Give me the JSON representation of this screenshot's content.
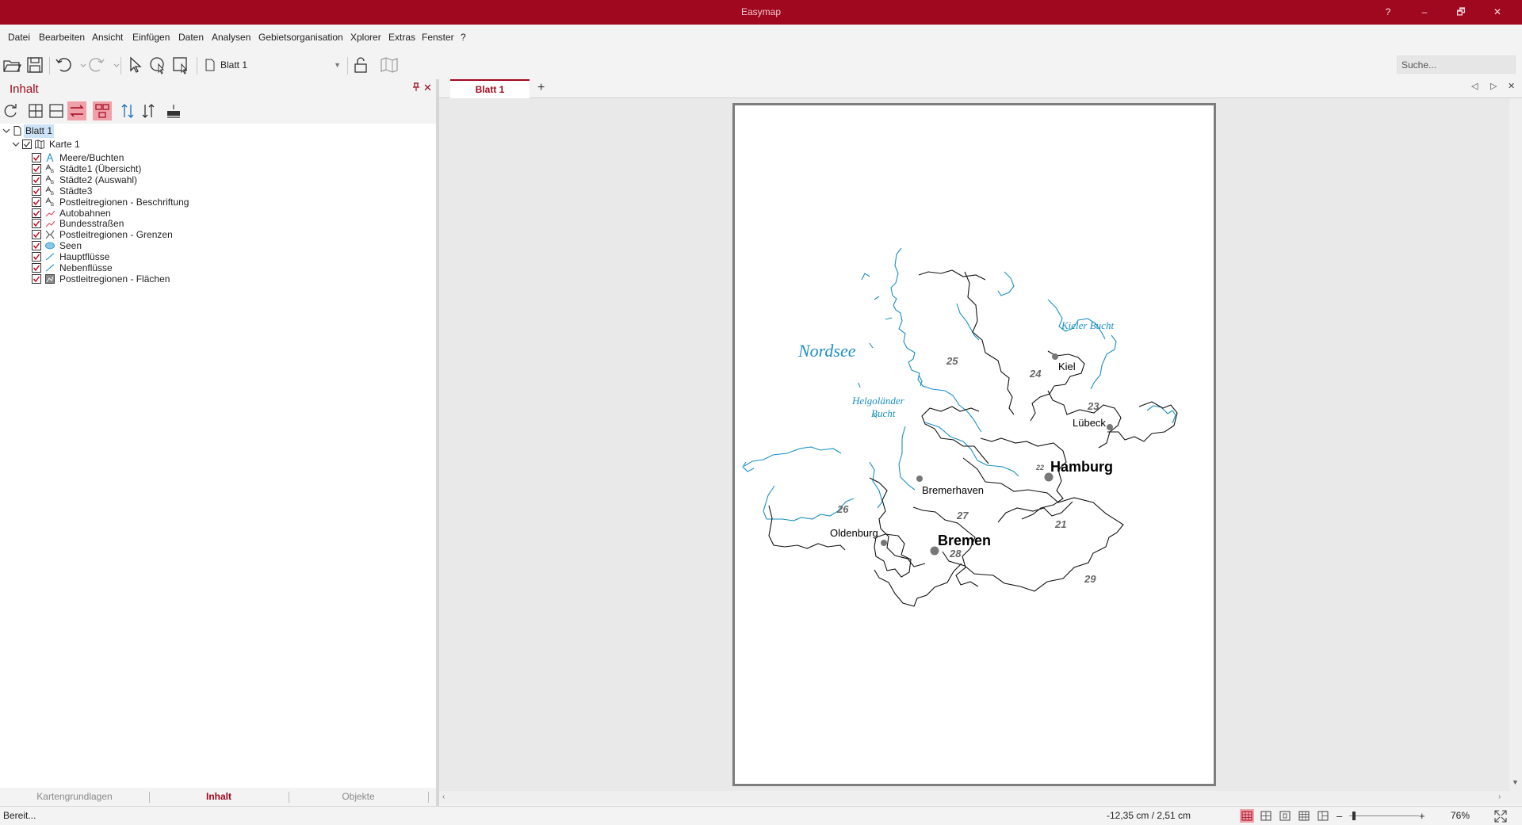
{
  "app": {
    "title": "Easymap",
    "window_controls": {
      "help": "?",
      "minimize": "–",
      "restore": "🗗",
      "close": "✕"
    }
  },
  "menu": [
    "Datei",
    "Bearbeiten",
    "Ansicht",
    "Einfügen",
    "Daten",
    "Analysen",
    "Gebietsorganisation",
    "Xplorer",
    "Extras",
    "Fenster",
    "?"
  ],
  "toolbar": {
    "page_select": "Blatt 1",
    "search_placeholder": "Suche..."
  },
  "panel": {
    "title": "Inhalt",
    "pin": "📌",
    "close": "✕",
    "tree": {
      "root": "Blatt 1",
      "map": "Karte 1",
      "layers": [
        {
          "label": "Meere/Buchten",
          "icon": "text-layer-icon",
          "checked": true
        },
        {
          "label": "Städte1 (Übersicht)",
          "icon": "label-layer-icon",
          "checked": true
        },
        {
          "label": "Städte2 (Auswahl)",
          "icon": "label-layer-icon",
          "checked": true
        },
        {
          "label": "Städte3",
          "icon": "label-layer-icon",
          "checked": true
        },
        {
          "label": "Postleitregionen - Beschriftung",
          "icon": "label-layer-icon",
          "checked": true
        },
        {
          "label": "Autobahnen",
          "icon": "road-layer-icon",
          "checked": true
        },
        {
          "label": "Bundesstraßen",
          "icon": "road-layer-icon",
          "checked": true
        },
        {
          "label": "Postleitregionen - Grenzen",
          "icon": "border-layer-icon",
          "checked": true
        },
        {
          "label": "Seen",
          "icon": "lake-layer-icon",
          "checked": true
        },
        {
          "label": "Hauptflüsse",
          "icon": "river-layer-icon",
          "checked": true
        },
        {
          "label": "Nebenflüsse",
          "icon": "river-layer-icon",
          "checked": true
        },
        {
          "label": "Postleitregionen - Flächen",
          "icon": "area-layer-icon",
          "checked": true
        }
      ]
    },
    "bottom_tabs": [
      "Kartengrundlagen",
      "Inhalt",
      "Objekte"
    ],
    "active_bottom_tab": "Inhalt"
  },
  "document": {
    "tab": "Blatt 1",
    "add_tab": "+",
    "map_labels": {
      "seas": [
        "Nordsee",
        "Kieler Bucht",
        "Helgoländer",
        "Bucht"
      ],
      "cities": [
        "Kiel",
        "Lübeck",
        "Hamburg",
        "Bremerhaven",
        "Oldenburg",
        "Bremen"
      ],
      "regions": [
        "25",
        "24",
        "23",
        "22",
        "21",
        "26",
        "27",
        "28",
        "29"
      ]
    }
  },
  "status": {
    "text": "Bereit...",
    "coords": "-12,35 cm / 2,51 cm",
    "zoom_minus": "–",
    "zoom_plus": "+",
    "zoom": "76%",
    "zoom_level": 0.04
  },
  "colors": {
    "accent": "#a0081f",
    "water": "#1a8fc4",
    "border": "#111111",
    "city_dot": "#777777",
    "region_label": "#666666"
  }
}
